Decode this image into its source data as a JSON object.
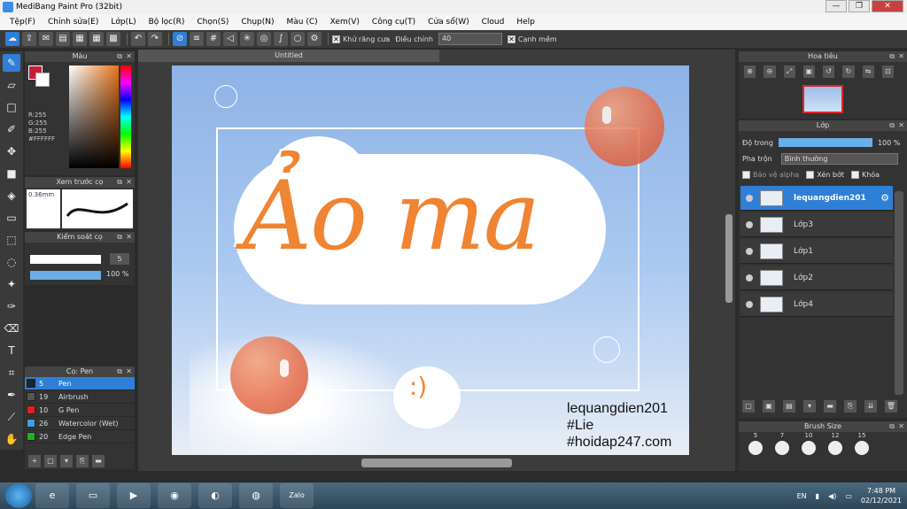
{
  "window": {
    "title": "MediBang Paint Pro (32bit)"
  },
  "menu": [
    "Tệp(F)",
    "Chỉnh sửa(E)",
    "Lớp(L)",
    "Bộ lọc(R)",
    "Chọn(S)",
    "Chụp(N)",
    "Màu (C)",
    "Xem(V)",
    "Công cụ(T)",
    "Cửa sổ(W)",
    "Cloud",
    "Help"
  ],
  "toolbar": {
    "antialias_label": "Khử răng cưa",
    "adjust_label": "Điều chỉnh",
    "adjust_value": "40",
    "edge_label": "Cạnh mềm"
  },
  "color_panel": {
    "title": "Màu",
    "r": "R:255",
    "g": "G:255",
    "b": "B:255",
    "hex": "#FFFFFF",
    "fg_color": "#c41e3a",
    "bg_color": "#ffffff"
  },
  "brush_preview": {
    "title": "Xem trước cọ",
    "size": "0.36mm"
  },
  "brush_control": {
    "title": "Kiểm soát cọ",
    "size_value": "5",
    "opacity_value": "100 %"
  },
  "pen_panel": {
    "title": "Cọ: Pen",
    "items": [
      {
        "num": "5",
        "name": "Pen",
        "color": "#222222",
        "active": true
      },
      {
        "num": "19",
        "name": "Airbrush",
        "color": "#555555"
      },
      {
        "num": "10",
        "name": "G Pen",
        "color": "#e02020"
      },
      {
        "num": "26",
        "name": "Watercolor (Wet)",
        "color": "#40a0e0"
      },
      {
        "num": "20",
        "name": "Edge Pen",
        "color": "#20b020"
      }
    ]
  },
  "document": {
    "tab": "Untitled"
  },
  "artwork": {
    "headline": "Ảo ma",
    "watermark": [
      "lequangdien201",
      "#Lie",
      "#hoidap247.com"
    ],
    "smile": ":)"
  },
  "navigator": {
    "title": "Hoa tiêu"
  },
  "layer_panel": {
    "title": "Lớp",
    "opacity_label": "Độ trong",
    "opacity_value": "100 %",
    "blend_label": "Pha trộn",
    "blend_value": "Bình thường",
    "protect_alpha": "Bảo vệ alpha",
    "clip": "Xén bớt",
    "lock": "Khóa",
    "layers": [
      "lequangdien201",
      "Lớp3",
      "Lớp1",
      "Lớp2",
      "Lớp4"
    ]
  },
  "brush_size": {
    "title": "Brush Size",
    "sizes": [
      "5",
      "7",
      "10",
      "12",
      "15"
    ]
  },
  "taskbar": {
    "lang": "EN",
    "time": "7:48 PM",
    "date": "02/12/2021",
    "zalo": "Zalo"
  }
}
